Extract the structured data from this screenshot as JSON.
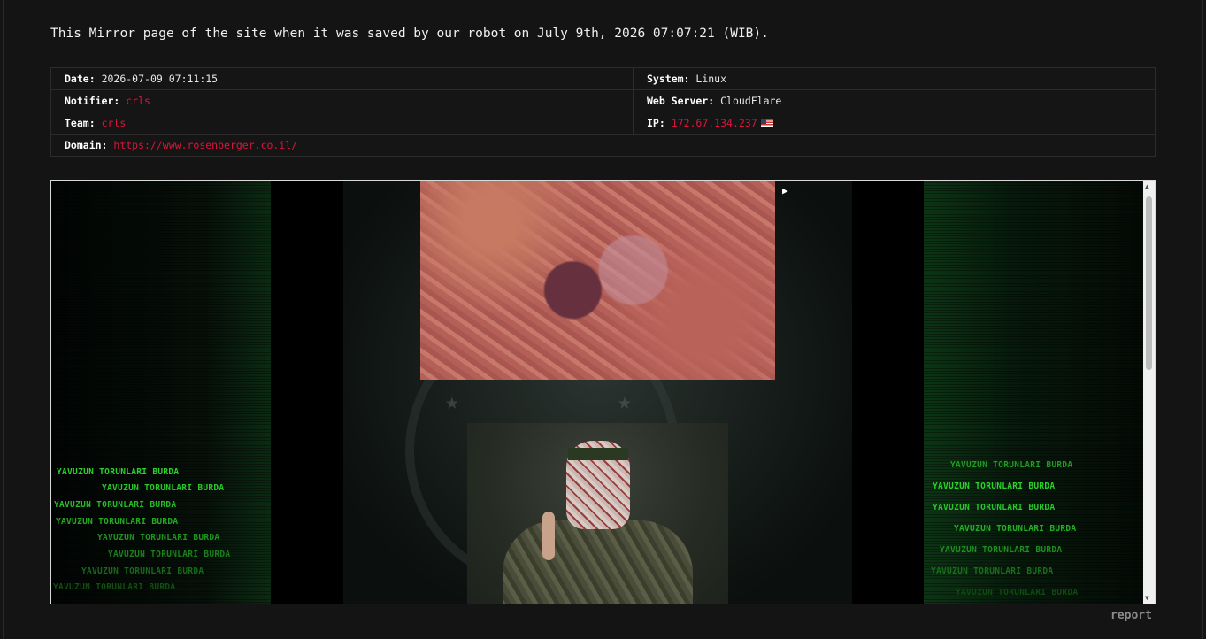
{
  "intro": "This Mirror page of the site when it was saved by our robot on July 9th, 2026 07:07:21 (WIB).",
  "info": {
    "date_label": "Date:",
    "date_value": "2026-07-09 07:11:15",
    "system_label": "System:",
    "system_value": "Linux",
    "notifier_label": "Notifier:",
    "notifier_value": "crls",
    "webserver_label": "Web Server:",
    "webserver_value": "CloudFlare",
    "team_label": "Team:",
    "team_value": "crls",
    "ip_label": "IP:",
    "ip_value": "172.67.134.237",
    "ip_flag_icon": "us-flag-icon",
    "domain_label": "Domain:",
    "domain_value": "https://www.rosenberger.co.il/"
  },
  "mirror": {
    "banner_text": "YAVUZUN TORUNLARI BURDA",
    "play_icon": "play-icon"
  },
  "colors": {
    "accent_red": "#dc143c",
    "matrix_green": "#22cc22"
  },
  "report_label": "report"
}
